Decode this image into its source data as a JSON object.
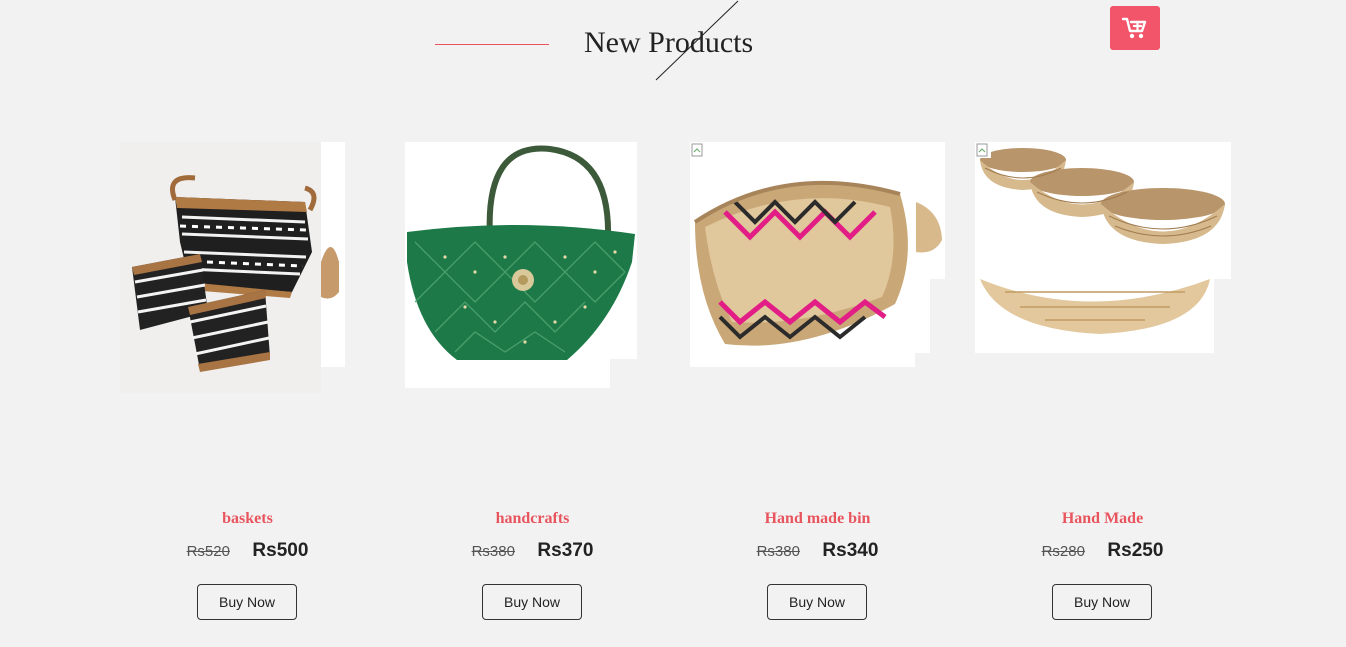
{
  "header": {
    "title": "New Products"
  },
  "colors": {
    "accent": "#e8555f",
    "cart_button": "#f2546a",
    "background": "#f3f2f2"
  },
  "icons": {
    "cart": "cart-plus-icon"
  },
  "products": [
    {
      "name": "baskets",
      "old_price": "Rs520",
      "price": "Rs500",
      "button": "Buy Now"
    },
    {
      "name": "handcrafts",
      "old_price": "Rs380",
      "price": "Rs370",
      "button": "Buy Now"
    },
    {
      "name": "Hand made bin",
      "old_price": "Rs380",
      "price": "Rs340",
      "button": "Buy Now"
    },
    {
      "name": "Hand Made",
      "old_price": "Rs280",
      "price": "Rs250",
      "button": "Buy Now"
    }
  ]
}
